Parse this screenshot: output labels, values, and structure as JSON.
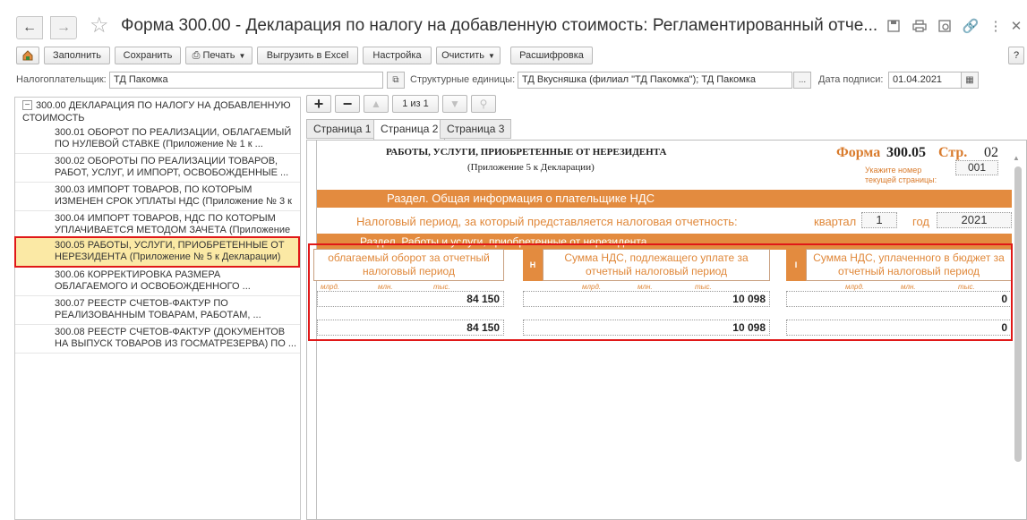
{
  "window": {
    "title": "Форма 300.00 - Декларация по налогу на добавленную стоимость: Регламентированный отче..."
  },
  "toolbar": {
    "fill": "Заполнить",
    "save": "Сохранить",
    "print": "Печать",
    "export_excel": "Выгрузить в Excel",
    "settings": "Настройка",
    "clear": "Очистить",
    "decode": "Расшифровка",
    "more": "?"
  },
  "fields": {
    "taxpayer_label": "Налогоплательщик:",
    "taxpayer_value": "ТД Пакомка",
    "units_label": "Структурные единицы:",
    "units_value": "ТД Вкусняшка (филиал \"ТД Пакомка\"); ТД Пакомка",
    "sign_date_label": "Дата подписи:",
    "sign_date_value": "01.04.2021",
    "ellipsis": "..."
  },
  "tree": {
    "root": "300.00 ДЕКЛАРАЦИЯ ПО НАЛОГУ НА ДОБАВЛЕННУЮ СТОИМОСТЬ",
    "items": [
      {
        "label": "300.01 ОБОРОТ ПО РЕАЛИЗАЦИИ, ОБЛАГАЕМЫЙ ПО НУЛЕВОЙ СТАВКЕ (Приложение № 1 к ..."
      },
      {
        "label": "300.02 ОБОРОТЫ ПО РЕАЛИЗАЦИИ ТОВАРОВ, РАБОТ, УСЛУГ, И ИМПОРТ, ОСВОБОЖДЕННЫЕ ..."
      },
      {
        "label": "300.03 ИМПОРТ ТОВАРОВ, ПО КОТОРЫМ ИЗМЕНЕН СРОК УПЛАТЫ НДС (Приложение № 3 к"
      },
      {
        "label": "300.04 ИМПОРТ ТОВАРОВ, НДС ПО КОТОРЫМ УПЛАЧИВАЕТСЯ МЕТОДОМ ЗАЧЕТА (Приложение"
      },
      {
        "label": "300.05 РАБОТЫ, УСЛУГИ, ПРИОБРЕТЕННЫЕ ОТ НЕРЕЗИДЕНТА (Приложение № 5 к Декларации)"
      },
      {
        "label": "300.06 КОРРЕКТИРОВКА РАЗМЕРА ОБЛАГАЕМОГО И ОСВОБОЖДЕННОГО ..."
      },
      {
        "label": "300.07 РЕЕСТР СЧЕТОВ-ФАКТУР ПО РЕАЛИЗОВАННЫМ ТОВАРАМ, РАБОТАМ, ..."
      },
      {
        "label": "300.08 РЕЕСТР СЧЕТОВ-ФАКТУР (ДОКУМЕНТОВ НА ВЫПУСК ТОВАРОВ ИЗ ГОСМАТРЕЗЕРВА) ПО ..."
      }
    ],
    "selected_index": 4
  },
  "pager": {
    "add": "+",
    "remove": "−",
    "position": "1 из 1"
  },
  "tabs": [
    "Страница 1",
    "Страница 2",
    "Страница 3"
  ],
  "active_tab": 1,
  "form": {
    "title": "РАБОТЫ, УСЛУГИ, ПРИОБРЕТЕННЫЕ ОТ НЕРЕЗИДЕНТА",
    "subtitle": "(Приложение 5 к Декларации)",
    "forma_label": "Форма",
    "forma_num": "300.05",
    "page_label": "Стр.",
    "page_num": "02",
    "page_hint": "Укажите номер текущей страницы:",
    "page_current": "001",
    "section1": "Раздел. Общая информация о плательщике НДС",
    "period_label": "Налоговый период, за который представляется налоговая отчетность:",
    "quarter_label": "квартал",
    "quarter_value": "1",
    "year_label": "год",
    "year_value": "2021",
    "section2": "Раздел. Работы и услуги, приобретенные от нерезидента",
    "col1_head": "облагаемый оборот за отчетный налоговый период",
    "col2_letter": "H",
    "col2_head": "Сумма НДС, подлежащего уплате за отчетный налоговый период",
    "col3_letter": "I",
    "col3_head": "Сумма НДС, уплаченного в бюджет за отчетный налоговый период",
    "unit_mlrd": "млрд.",
    "unit_mln": "млн.",
    "unit_tys": "тыс.",
    "row1": [
      "84 150",
      "10 098",
      "0"
    ],
    "row2": [
      "84 150",
      "10 098",
      "0"
    ]
  },
  "colors": {
    "accent_orange": "#e38b3f",
    "selection_yellow": "#fbe9a5",
    "highlight_red": "#e01818"
  }
}
